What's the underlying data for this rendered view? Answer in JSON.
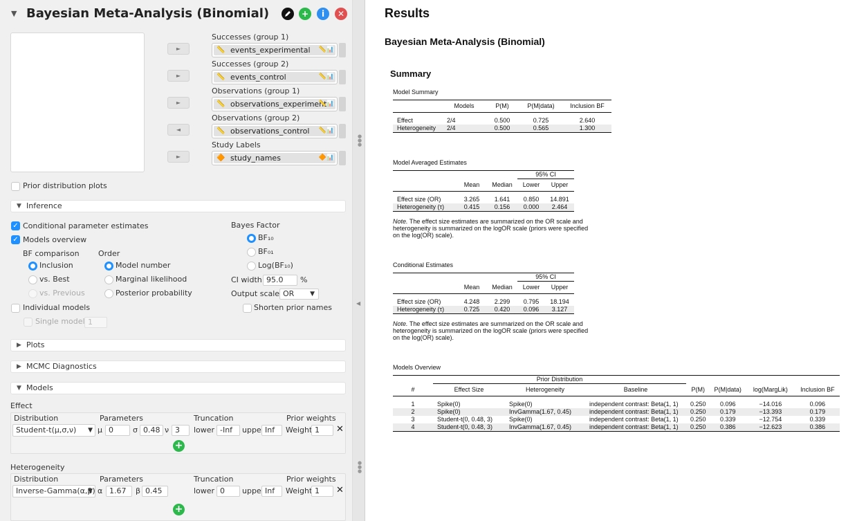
{
  "options": {
    "analysis_title": "Bayesian Meta-Analysis (Binomial)",
    "header_icons": [
      "edit-icon",
      "add-icon",
      "info-icon",
      "close-icon"
    ],
    "assign": [
      {
        "label": "Successes (group 1)",
        "variable": "events_experimental",
        "arrow": "►"
      },
      {
        "label": "Successes (group 2)",
        "variable": "events_control",
        "arrow": "►"
      },
      {
        "label": "Observations (group 1)",
        "variable": "observations_experimental",
        "arrow": "►"
      },
      {
        "label": "Observations (group 2)",
        "variable": "observations_control",
        "arrow": "◄"
      },
      {
        "label": "Study Labels",
        "variable": "study_names",
        "arrow": "►"
      }
    ],
    "prior_plots_label": "Prior distribution plots",
    "inference": {
      "section_label": "Inference",
      "cond_estimates": "Conditional parameter estimates",
      "models_overview": "Models overview",
      "bf_comparison": {
        "label": "BF comparison",
        "options": [
          "Inclusion",
          "vs. Best",
          "vs. Previous"
        ]
      },
      "order": {
        "label": "Order",
        "options": [
          "Model number",
          "Marginal likelihood",
          "Posterior probability"
        ]
      },
      "individual_models": "Individual models",
      "single_model": "Single model",
      "single_model_value": "1",
      "bayes_factor": {
        "label": "Bayes Factor",
        "options": [
          "BF₁₀",
          "BF₀₁",
          "Log(BF₁₀)"
        ]
      },
      "ci_width_label": "CI width",
      "ci_width_value": "95.0",
      "ci_width_unit": "%",
      "output_scale_label": "Output scale",
      "output_scale_value": "OR",
      "shorten_prior": "Shorten prior names"
    },
    "plots_label": "Plots",
    "mcmc_label": "MCMC Diagnostics",
    "models_label": "Models",
    "column_headers": {
      "distribution": "Distribution",
      "parameters": "Parameters",
      "truncation": "Truncation",
      "prior_weights": "Prior weights",
      "lower": "lower",
      "upper": "upper",
      "weight": "Weight"
    },
    "effect": {
      "label": "Effect",
      "distribution": "Student-t(μ,σ,ν)",
      "params": [
        {
          "sym": "μ",
          "val": "0"
        },
        {
          "sym": "σ",
          "val": "0.48"
        },
        {
          "sym": "ν",
          "val": "3"
        }
      ],
      "lower": "-Inf",
      "upper": "Inf",
      "weight": "1"
    },
    "heterogeneity": {
      "label": "Heterogeneity",
      "distribution": "Inverse-Gamma(α,β)",
      "params": [
        {
          "sym": "α",
          "val": "1.67"
        },
        {
          "sym": "β",
          "val": "0.45"
        }
      ],
      "lower": "0",
      "upper": "Inf",
      "weight": "1"
    }
  },
  "results": {
    "title": "Results",
    "analysis_title": "Bayesian Meta-Analysis (Binomial)",
    "summary_title": "Summary",
    "model_summary": {
      "title": "Model Summary",
      "headers": [
        "",
        "Models",
        "P(M)",
        "P(M|data)",
        "Inclusion BF"
      ],
      "rows": [
        [
          "Effect",
          "2/4",
          "0.500",
          "0.725",
          "2.640"
        ],
        [
          "Heterogeneity",
          "2/4",
          "0.500",
          "0.565",
          "1.300"
        ]
      ]
    },
    "model_averaged": {
      "title": "Model Averaged Estimates",
      "ci_label": "95% CI",
      "headers": [
        "",
        "Mean",
        "Median",
        "Lower",
        "Upper"
      ],
      "rows": [
        [
          "Effect size (OR)",
          "3.265",
          "1.641",
          "0.850",
          "14.891"
        ],
        [
          "Heterogeneity (τ)",
          "0.415",
          "0.156",
          "0.000",
          "2.464"
        ]
      ],
      "note_label": "Note.",
      "note": " The effect size estimates are summarized on the OR scale and heterogeneity is summarized on the logOR scale (priors were specified on the log(OR) scale)."
    },
    "conditional": {
      "title": "Conditional Estimates",
      "ci_label": "95% CI",
      "headers": [
        "",
        "Mean",
        "Median",
        "Lower",
        "Upper"
      ],
      "rows": [
        [
          "Effect size (OR)",
          "4.248",
          "2.299",
          "0.795",
          "18.194"
        ],
        [
          "Heterogeneity (τ)",
          "0.725",
          "0.420",
          "0.096",
          "3.127"
        ]
      ],
      "note_label": "Note.",
      "note": " The effect size estimates are summarized on the OR scale and heterogeneity is summarized on the logOR scale (priors were specified on the log(OR) scale)."
    },
    "models_overview": {
      "title": "Models Overview",
      "prior_group": "Prior Distribution",
      "headers": [
        "#",
        "Effect Size",
        "Heterogeneity",
        "Baseline",
        "P(M)",
        "P(M|data)",
        "log(MargLik)",
        "Inclusion BF"
      ],
      "rows": [
        [
          "1",
          "Spike(0)",
          "Spike(0)",
          "independent contrast: Beta(1, 1)",
          "0.250",
          "0.096",
          "−14.016",
          "0.096"
        ],
        [
          "2",
          "Spike(0)",
          "InvGamma(1.67, 0.45)",
          "independent contrast: Beta(1, 1)",
          "0.250",
          "0.179",
          "−13.393",
          "0.179"
        ],
        [
          "3",
          "Student-t(0, 0.48, 3)",
          "Spike(0)",
          "independent contrast: Beta(1, 1)",
          "0.250",
          "0.339",
          "−12.754",
          "0.339"
        ],
        [
          "4",
          "Student-t(0, 0.48, 3)",
          "InvGamma(1.67, 0.45)",
          "independent contrast: Beta(1, 1)",
          "0.250",
          "0.386",
          "−12.623",
          "0.386"
        ]
      ]
    }
  }
}
